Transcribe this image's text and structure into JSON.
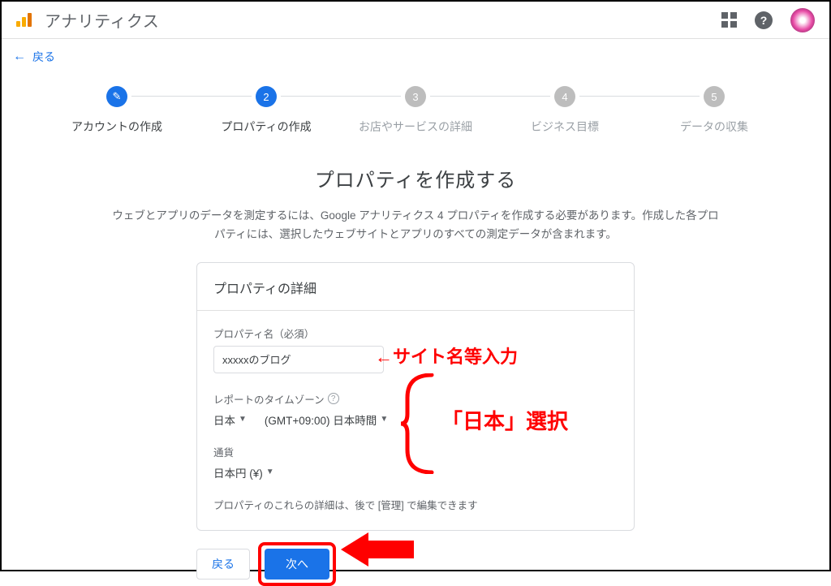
{
  "header": {
    "app_title": "アナリティクス"
  },
  "back_link": "戻る",
  "steps": [
    {
      "num": "",
      "label": "アカウントの作成",
      "state": "done"
    },
    {
      "num": "2",
      "label": "プロパティの作成",
      "state": "active"
    },
    {
      "num": "3",
      "label": "お店やサービスの詳細",
      "state": "future"
    },
    {
      "num": "4",
      "label": "ビジネス目標",
      "state": "future"
    },
    {
      "num": "5",
      "label": "データの収集",
      "state": "future"
    }
  ],
  "main": {
    "heading": "プロパティを作成する",
    "description": "ウェブとアプリのデータを測定するには、Google アナリティクス 4 プロパティを作成する必要があります。作成した各プロパティには、選択したウェブサイトとアプリのすべての測定データが含まれます。"
  },
  "card": {
    "title": "プロパティの詳細",
    "prop_name_label": "プロパティ名（必須）",
    "prop_name_value": "xxxxxのブログ",
    "tz_label": "レポートのタイムゾーン",
    "tz_country": "日本",
    "tz_value": "(GMT+09:00) 日本時間",
    "currency_label": "通貨",
    "currency_value": "日本円 (¥)",
    "note": "プロパティのこれらの詳細は、後で [管理] で編集できます"
  },
  "footer": {
    "back": "戻る",
    "next": "次へ"
  },
  "annotations": {
    "line1": "←サイト名等入力",
    "line2": "「日本」選択"
  }
}
